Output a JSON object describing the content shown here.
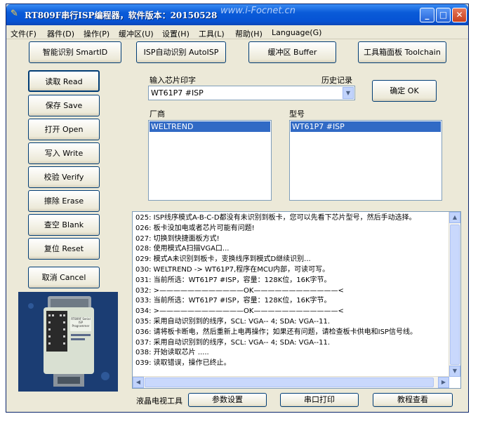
{
  "window": {
    "title": "RT809F串行ISP编程器，软件版本：20150528",
    "watermark": "www.i-Focnet.cn",
    "controls": {
      "minimize": "_",
      "maximize": "□",
      "close": "✕"
    }
  },
  "menu": [
    "文件(F)",
    "器件(D)",
    "操作(P)",
    "缓冲区(U)",
    "设置(H)",
    "工具(L)",
    "帮助(H)",
    "Language(G)"
  ],
  "top_buttons": {
    "smartid": "智能识别 SmartID",
    "autoisp": "ISP自动识别 AutoISP",
    "buffer": "缓冲区 Buffer",
    "toolchain": "工具箱面板 Toolchain"
  },
  "side_buttons": {
    "read": "读取 Read",
    "save": "保存 Save",
    "open": "打开 Open",
    "write": "写入 Write",
    "verify": "校验 Verify",
    "erase": "擦除 Erase",
    "blank": "查空 Blank",
    "reset": "复位 Reset",
    "cancel": "取消 Cancel"
  },
  "chip_input": {
    "label": "输入芯片印字",
    "history_label": "历史记录",
    "value": "WT61P7 #ISP",
    "ok_button": "确定 OK"
  },
  "vendor": {
    "label": "厂商",
    "selected": "WELTREND"
  },
  "model": {
    "label": "型号",
    "selected": "WT61P7 #ISP"
  },
  "log_lines": [
    "025: ISP线序模式A-B-C-D都没有未识别到板卡，您可以先看下芯片型号，然后手动选择。",
    "026: 板卡没加电或者芯片可能有问题!",
    "027: 切换到快捷面板方式!",
    "028: 使用模式A扫描VGA口...",
    "029: 模式A未识别到板卡，变换线序到模式D继续识别...",
    "030: WELTREND -> WT61P7,程序在MCU内部，可读可写。",
    "031: 当前所选：WT61P7 #ISP，容量：128K位，16K字节。",
    "032: >————————————OK————————————<",
    "033: 当前所选：WT61P7 #ISP，容量：128K位，16K字节。",
    "034: >————————————OK————————————<",
    "035: 采用自动识别到的线序，SCL: VGA-- 4; SDA: VGA--11.",
    "036: 请将板卡断电，然后重新上电再操作；如果还有问题，请检查板卡供电和ISP信号线。",
    "037: 采用自动识别到的线序，SCL: VGA-- 4; SDA: VGA--11.",
    "038: 开始读取芯片 .....",
    "039: 读取错误，操作已终止。"
  ],
  "bottom_bar": {
    "label": "液晶电视工具",
    "params": "参数设置",
    "serial_print": "串口打印",
    "tutorial": "教程查看"
  },
  "device_image": {
    "label": "RT809F Serial ISP Programmer"
  },
  "colors": {
    "titlebar": "#0653d4",
    "selection": "#316ac5",
    "window_bg": "#ece9d8"
  }
}
